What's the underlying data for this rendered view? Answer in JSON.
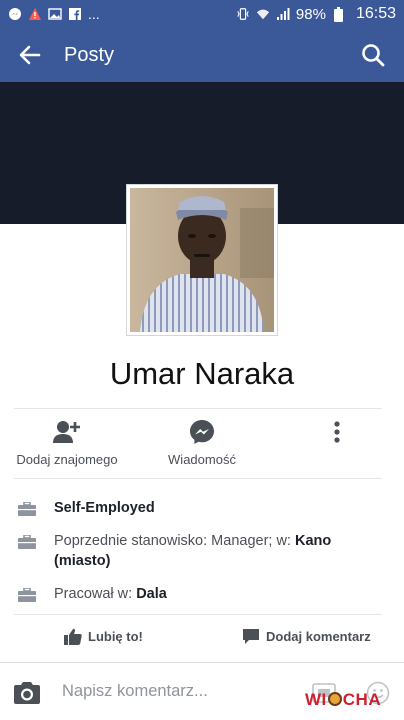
{
  "status_bar": {
    "battery": "98%",
    "time": "16:53",
    "more": "..."
  },
  "app_bar": {
    "title": "Posty"
  },
  "profile": {
    "name": "Umar Naraka"
  },
  "actions": {
    "add_friend": "Dodaj znajomego",
    "message": "Wiadomość"
  },
  "info": {
    "employer": "Self-Employed",
    "previous_prefix": "Poprzednie stanowisko: Manager; w: ",
    "previous_place": "Kano (miasto)",
    "worked_prefix": "Pracował w: ",
    "worked_place": "Dala"
  },
  "feedback": {
    "like": "Lubię to!",
    "comment": "Dodaj komentarz"
  },
  "composer": {
    "placeholder": "Napisz komentarz..."
  },
  "watermark": {
    "part1": "WI",
    "part2": "CHA"
  },
  "colors": {
    "brand": "#3b5998",
    "cover": "#161c29",
    "icon_gray": "#4b4f56"
  }
}
